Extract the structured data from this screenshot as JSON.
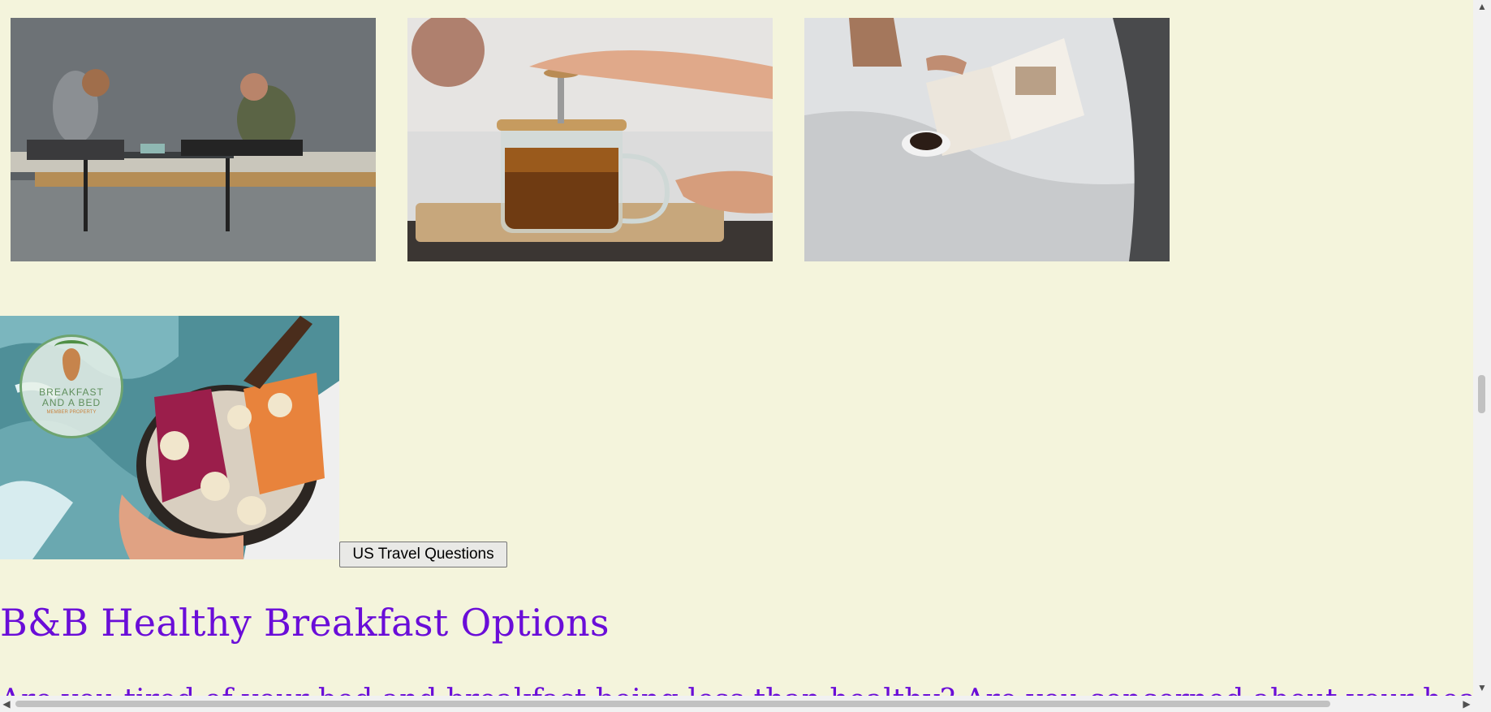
{
  "gallery": {
    "photos": [
      {
        "name": "couple-tea-photo"
      },
      {
        "name": "french-press-photo"
      },
      {
        "name": "coffee-in-bed-photo"
      }
    ]
  },
  "promo": {
    "badge_line1": "BREAKFAST",
    "badge_line2": "AND A BED",
    "badge_line3": "MEMBER PROPERTY"
  },
  "travel_button": {
    "label": "US Travel Questions"
  },
  "heading": "B&B Healthy Breakfast Options",
  "intro_text": "Are you tired of your bed and breakfast being less than healthy? Are you concerned about your health",
  "scrollbars": {
    "up_arrow": "▲",
    "down_arrow": "▼",
    "left_arrow": "◀",
    "right_arrow": "▶"
  }
}
